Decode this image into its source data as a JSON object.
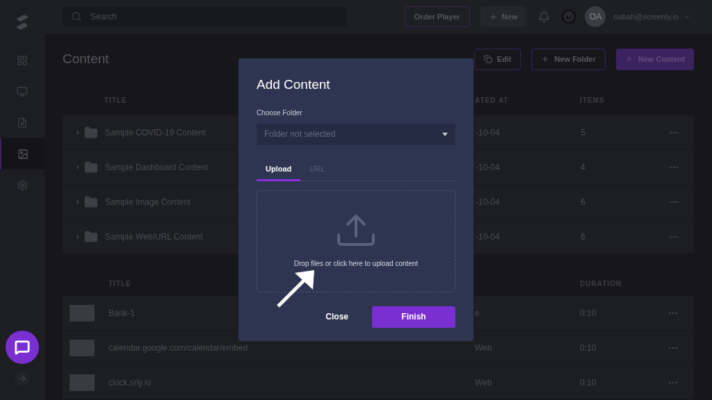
{
  "sidebar": {
    "items": [
      {
        "selected": false
      },
      {
        "selected": false
      },
      {
        "selected": false
      },
      {
        "selected": true
      },
      {
        "selected": false
      }
    ]
  },
  "topbar": {
    "search": {
      "placeholder": "Search"
    },
    "order_button": "Order Player",
    "new_button": "New",
    "avatar": "OA",
    "email": "oabah@screenly.io"
  },
  "page": {
    "title": "Content",
    "actions": [
      {
        "label": "Edit",
        "kind": "edit"
      },
      {
        "label": "New Folder",
        "kind": "outline"
      },
      {
        "label": "New Content",
        "kind": "primary"
      }
    ]
  },
  "folders": {
    "columns": [
      "TITLE",
      "ATED AT",
      "ITEMS"
    ],
    "rows": [
      {
        "title": "Sample COVID-19 Content",
        "created": "-10-04",
        "items": "5"
      },
      {
        "title": "Sample Dashboard Content",
        "created": "-10-04",
        "items": "4"
      },
      {
        "title": "Sample Image Content",
        "created": "-10-04",
        "items": "6"
      },
      {
        "title": "Sample Web/URL Content",
        "created": "-10-04",
        "items": "6"
      }
    ]
  },
  "assets": {
    "columns": [
      "TITLE",
      "DURATION"
    ],
    "rows": [
      {
        "title": "Bank-1",
        "type": "e",
        "duration": "0:10"
      },
      {
        "title": "calendar.google.com/calendar/embed",
        "type": "Web",
        "duration": "0:10"
      },
      {
        "title": "clock.srly.io",
        "type": "Web",
        "duration": "0:10"
      }
    ]
  },
  "dialog": {
    "title": "Add Content",
    "folder_label": "Choose Folder",
    "folder_placeholder": "Folder not selected",
    "tabs": [
      {
        "label": "Upload",
        "selected": true
      },
      {
        "label": "URL",
        "selected": false
      }
    ],
    "dropzone_text": "Drop files or click here to upload content",
    "buttons": [
      {
        "label": "Close",
        "kind": "text"
      },
      {
        "label": "Finish",
        "kind": "primary"
      }
    ]
  }
}
